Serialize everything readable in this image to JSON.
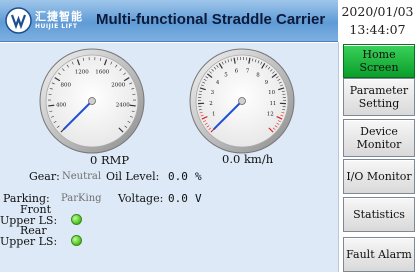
{
  "header": {
    "logo_cn": "汇捷智能",
    "logo_en": "HUIJIE LIFT",
    "title": "Multi-functional Straddle Carrier",
    "date": "2020/01/03",
    "time": "13:44:07"
  },
  "gauges": {
    "rpm": {
      "value": 0,
      "value_text": "0",
      "unit": "RMP",
      "max": 2800,
      "ticks": [
        "400",
        "800",
        "1200",
        "1600",
        "2000",
        "2400"
      ]
    },
    "speed": {
      "value": 0.0,
      "value_text": "0.0",
      "unit": "km/h",
      "max": 12,
      "ticks": [
        "1",
        "2",
        "3",
        "4",
        "5",
        "6",
        "7",
        "8",
        "9",
        "10",
        "11",
        "12"
      ]
    }
  },
  "status": {
    "gear_label": "Gear:",
    "gear_value": "Neutral",
    "oil_label": "Oil Level:",
    "oil_value": "0.0",
    "oil_unit": "%",
    "parking_label": "Parking:",
    "parking_value": "ParKing",
    "voltage_label": "Voltage:",
    "voltage_value": "0.0",
    "voltage_unit": "V",
    "front_label_1": "Front",
    "front_label_2": "Upper LS:",
    "rear_label_1": "Rear",
    "rear_label_2": "Upper LS:",
    "led_color": "#5cd12c"
  },
  "nav": {
    "home": "Home Screen",
    "param_1": "Parameter",
    "param_2": "Setting",
    "device_1": "Device",
    "device_2": "Monitor",
    "io": "I/O Monitor",
    "stats": "Statistics",
    "fault": "Fault Alarm"
  },
  "colors": {
    "active_nav": "#1fbf3f",
    "needle": "#1f4fd6",
    "header": "#6fa6dc"
  }
}
